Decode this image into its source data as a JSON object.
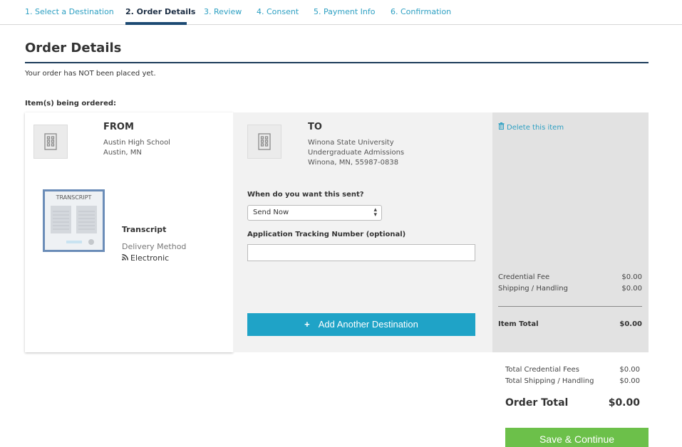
{
  "steps": [
    {
      "label": "1. Select a Destination"
    },
    {
      "label": "2. Order Details"
    },
    {
      "label": "3. Review"
    },
    {
      "label": "4. Consent"
    },
    {
      "label": "5. Payment Info"
    },
    {
      "label": "6. Confirmation"
    }
  ],
  "page": {
    "title": "Order Details",
    "notice": "Your order has NOT been placed yet.",
    "items_label": "Item(s) being ordered:"
  },
  "from": {
    "heading": "FROM",
    "school": "Austin High School",
    "location": "Austin, MN",
    "credential_thumb_label": "TRANSCRIPT",
    "credential_name": "Transcript",
    "delivery_method_label": "Delivery Method",
    "delivery_method": "Electronic"
  },
  "to": {
    "heading": "TO",
    "institution": "Winona State University",
    "department": "Undergraduate Admissions",
    "location": "Winona, MN, 55987-0838",
    "when_label": "When do you want this sent?",
    "when_value": "Send Now",
    "tracking_label": "Application Tracking Number (optional)",
    "tracking_value": "",
    "add_button": "Add Another Destination"
  },
  "fees": {
    "delete_link": "Delete this item",
    "credential_fee_label": "Credential Fee",
    "credential_fee": "$0.00",
    "shipping_label": "Shipping / Handling",
    "shipping": "$0.00",
    "item_total_label": "Item Total",
    "item_total": "$0.00"
  },
  "summary": {
    "total_credential_fees_label": "Total Credential Fees",
    "total_credential_fees": "$0.00",
    "total_shipping_label": "Total Shipping / Handling",
    "total_shipping": "$0.00",
    "order_total_label": "Order Total",
    "order_total": "$0.00",
    "save_button": "Save & Continue"
  },
  "colors": {
    "accent": "#2c9fc2",
    "add_button": "#1fa3c7",
    "save_button": "#6cc04a",
    "title_rule": "#1c3b5a"
  },
  "icons": [
    "building-icon",
    "trash-icon",
    "rss-icon",
    "plus-icon",
    "select-arrows-icon"
  ]
}
